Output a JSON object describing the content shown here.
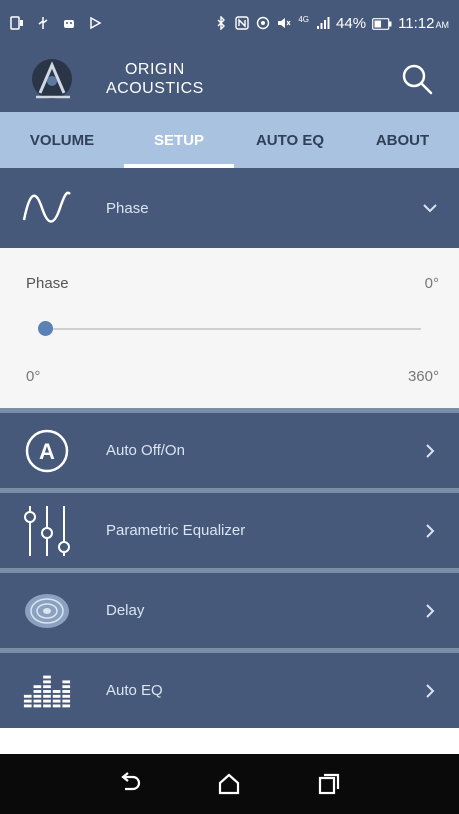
{
  "status_bar": {
    "battery_percent": "44%",
    "time": "11:12",
    "time_suffix": "AM",
    "signal_label": "4G"
  },
  "app_bar": {
    "brand_line1": "ORIGIN",
    "brand_line2": "ACOUSTICS",
    "logo_icon": "origin-acoustics-logo",
    "search_icon": "search-icon"
  },
  "tabs": [
    {
      "label": "VOLUME",
      "active": false
    },
    {
      "label": "SETUP",
      "active": true
    },
    {
      "label": "AUTO EQ",
      "active": false
    },
    {
      "label": "ABOUT",
      "active": false
    }
  ],
  "phase_header": {
    "label": "Phase",
    "icon": "sine-wave-icon",
    "chevron": "chevron-down-icon"
  },
  "phase_panel": {
    "title": "Phase",
    "value": "0°",
    "min_label": "0°",
    "max_label": "360°",
    "slider_value": 0
  },
  "menu": [
    {
      "label": "Auto Off/On",
      "icon": "auto-a-icon"
    },
    {
      "label": "Parametric Equalizer",
      "icon": "equalizer-sliders-icon"
    },
    {
      "label": "Delay",
      "icon": "delay-icon"
    },
    {
      "label": "Auto EQ",
      "icon": "bar-meter-icon"
    }
  ],
  "colors": {
    "primary": "#46597a",
    "tab_bar": "#a8c2e0",
    "accent": "#5b82b6",
    "nav_bar": "#0a0a0a"
  }
}
